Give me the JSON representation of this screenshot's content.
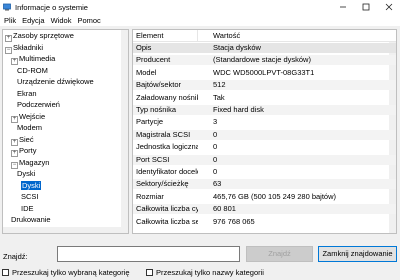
{
  "window": {
    "title": "Informacje o systemie",
    "icon": "system-info-icon"
  },
  "menu": [
    "Plik",
    "Edycja",
    "Widok",
    "Pomoc"
  ],
  "tree": [
    {
      "label": "Zasoby sprzętowe",
      "twisty": "+"
    },
    {
      "label": "Składniki",
      "twisty": "−"
    },
    {
      "label": "Multimedia",
      "twisty": "+"
    },
    {
      "label": "CD-ROM"
    },
    {
      "label": "Urządzenie dźwiękowe"
    },
    {
      "label": "Ekran"
    },
    {
      "label": "Podczerwień"
    },
    {
      "label": "Wejście",
      "twisty": "+"
    },
    {
      "label": "Modem"
    },
    {
      "label": "Sieć",
      "twisty": "+"
    },
    {
      "label": "Porty",
      "twisty": "+"
    },
    {
      "label": "Magazyn",
      "twisty": "−"
    },
    {
      "label": "Dyski"
    },
    {
      "label": "Dyski",
      "selected": true
    },
    {
      "label": "SCSI"
    },
    {
      "label": "IDE"
    },
    {
      "label": "Drukowanie"
    }
  ],
  "list": {
    "columns": [
      "Element",
      "Wartość"
    ],
    "rows": [
      [
        "Opis",
        "Stacja dysków"
      ],
      [
        "Producent",
        "(Standardowe stacje dysków)"
      ],
      [
        "Model",
        "WDC WD5000LPVT-08G33T1"
      ],
      [
        "Bajtów/sektor",
        "512"
      ],
      [
        "Załadowany nośnik",
        "Tak"
      ],
      [
        "Typ nośnika",
        "Fixed hard disk"
      ],
      [
        "Partycje",
        "3"
      ],
      [
        "Magistrala SCSI",
        "0"
      ],
      [
        "Jednostka logiczna ...",
        "0"
      ],
      [
        "Port SCSI",
        "0"
      ],
      [
        "Identyfikator docelo...",
        "0"
      ],
      [
        "Sektory/ścieżkę",
        "63"
      ],
      [
        "Rozmiar",
        "465,76 GB (500 105 249 280 bajtów)"
      ],
      [
        "Całkowita liczba cyli...",
        "60 801"
      ],
      [
        "Całkowita liczba sekt...",
        "976 768 065"
      ]
    ]
  },
  "find": {
    "label": "Znajdź:",
    "value": "",
    "find_button": "Znajdź",
    "close_button": "Zamknij znajdowanie",
    "option_selected_category": "Przeszukaj tylko wybraną kategorię",
    "option_category_names": "Przeszukaj tylko nazwy kategorii"
  }
}
